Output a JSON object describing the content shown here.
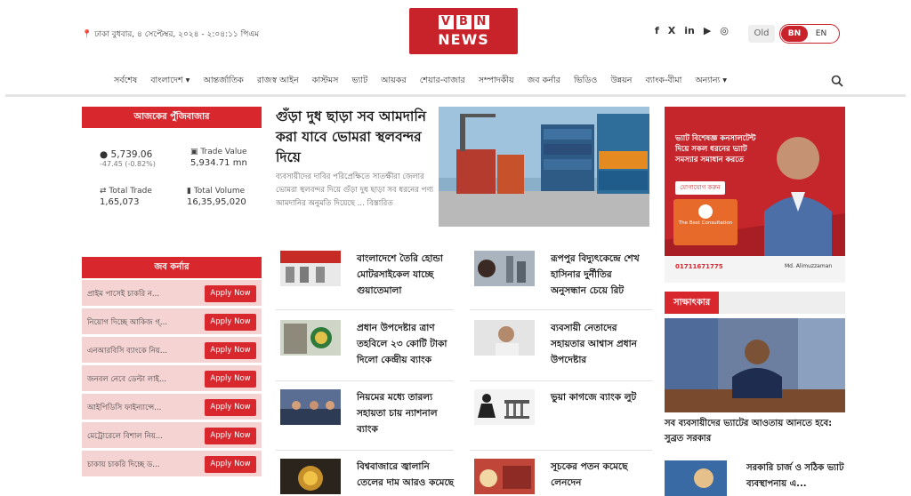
{
  "header": {
    "dateline": "ঢাকা বুধবার, ৪ সেপ্টেম্বর, ২০২৪ - ২:০৪:১১ পিএম",
    "logo_top": [
      "V",
      "B",
      "N"
    ],
    "logo_bottom": "NEWS",
    "social": [
      "f",
      "X",
      "in",
      "▶",
      "◎"
    ],
    "old_label": "Old",
    "lang_active": "BN",
    "lang_other": "EN"
  },
  "nav": {
    "items": [
      "সর্বশেষ",
      "বাংলাদেশ ▾",
      "আন্তর্জাতিক",
      "রাজস্ব আইন",
      "কাস্টমস",
      "ভ্যাট",
      "আয়কর",
      "শেয়ার-বাজার",
      "সম্পাদকীয়",
      "জব কর্নার",
      "ভিডিও",
      "উন্নয়ন",
      "ব্যাংক-বীমা",
      "অন্যান্য ▾"
    ]
  },
  "market": {
    "title": "আজকের পুঁজিবাজার",
    "index_value": "5,739.06",
    "index_change": "-47.45 (-0.82%)",
    "trade_value_label": "Trade Value",
    "trade_value": "5,934.71 mn",
    "total_trade_label": "Total Trade",
    "total_trade": "1,65,073",
    "total_volume_label": "Total Volume",
    "total_volume": "16,35,95,020"
  },
  "jobs": {
    "title": "জব কর্নার",
    "apply_label": "Apply Now",
    "items": [
      "প্রাইম পাসেই চাকরি ন...",
      "নিয়োগ দিচ্ছে আকিজ গ্...",
      "এনআরবিসি ব্যাংকে নিয়...",
      "জনবল নেবে ডেল্টা লাই...",
      "আইপিডিসি ফাইন্যান্সে...",
      "মেট্রোরেলে বিশাল নিয়...",
      "চাকায় চাকরি দিচ্ছে ড..."
    ]
  },
  "lead": {
    "title": "গুঁড়া দুধ ছাড়া সব আমদানি করা যাবে ভোমরা স্থলবন্দর দিয়ে",
    "summary": "ব্যবসায়ীদের দাবির পরিপ্রেক্ষিতে সাতক্ষীরা জেলার ভোমরা স্থলবন্দর দিয়ে গুঁড়া দুধ ছাড়া সব ধরনের পণ্য আমদানির অনুমতি দিয়েছে ... বিস্তারিত"
  },
  "news": [
    "বাংলাদেশে তৈরি হোন্ডা মোটরসাইকেল যাচ্ছে গুয়াতেমালা",
    "রূপপুর বিদ্যুৎকেন্দ্রে শেখ হাসিনার দুর্নীতির অনুসন্ধান চেয়ে রিট",
    "প্রধান উপদেষ্টার ত্রাণ তহবিলে ২৩ কোটি টাকা দিলো কেন্দ্রীয় ব্যাংক",
    "ব্যবসায়ী নেতাদের সহায়তার আশ্বাস প্রধান উপদেষ্টার",
    "নিয়মের মধ্যে তারল্য সহায়তা চায় ন্যাশনাল ব্যাংক",
    "ভুয়া কাগজে ব্যাংক লুট",
    "বিশ্ববাজারে জ্বালানি তেলের দাম আরও কমেছে",
    "সূচকের পতন কমেছে লেনদেন"
  ],
  "ad": {
    "headline": "ভ্যাট বিশেষজ্ঞ কনসালটেন্ট দিয়ে সকল ধরনের ভ্যাট সমস্যার সমাধান করতে",
    "cta": "যোগাযোগ করুন",
    "firm": "The Best Consultation",
    "phone": "01711671775",
    "name": "Md. Alimuzzaman"
  },
  "sakkhatkar": {
    "title": "সাক্ষাৎকার",
    "caption": "সব ব্যবসায়ীদের ভ্যাটের আওতায় আনতে হবে: সুব্রত সরকার",
    "news": "সরকারি চার্জ ও সঠিক ভ্যাট ব্যবস্থাপনায় এ..."
  }
}
